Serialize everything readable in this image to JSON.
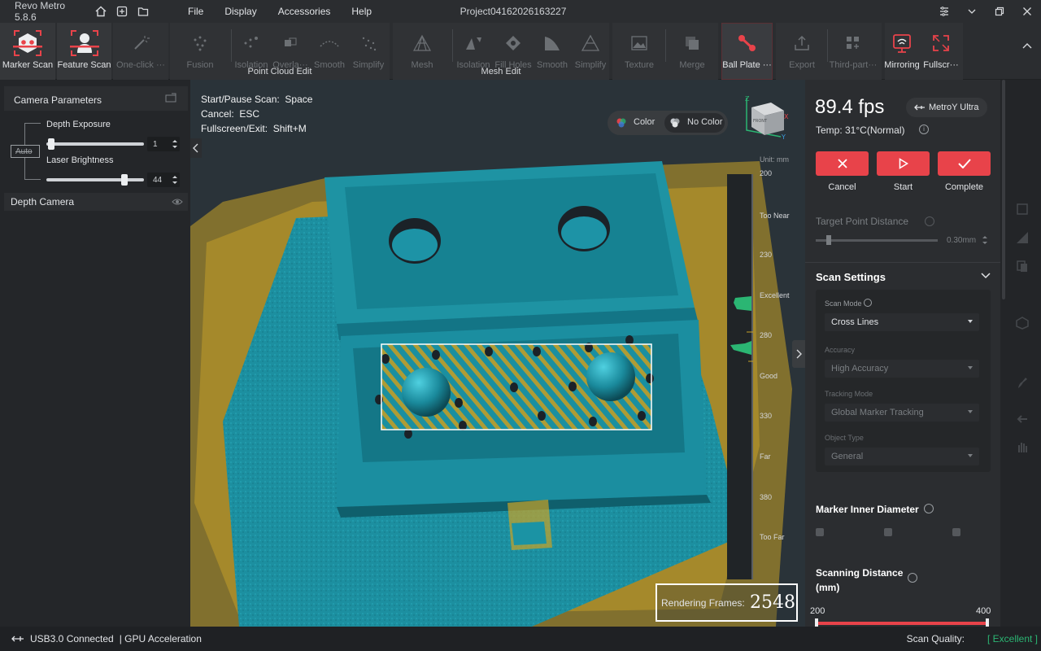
{
  "title_bar": {
    "app_name": "Revo Metro 5.8.6",
    "menu": [
      "File",
      "Display",
      "Accessories",
      "Help"
    ],
    "project_name": "Project04162026163227"
  },
  "toolbar": {
    "marker_scan": "Marker Scan",
    "feature_scan": "Feature Scan",
    "one_click": "One-click ···",
    "fusion": "Fusion",
    "pc_isolation": "Isolation",
    "overlap": "Overla···",
    "pc_smooth": "Smooth",
    "pc_simplify": "Simplify",
    "mesh": "Mesh",
    "mesh_isolation": "Isolation",
    "fill_holes": "Fill Holes",
    "mesh_smooth": "Smooth",
    "mesh_simplify": "Simplify",
    "texture": "Texture",
    "merge": "Merge",
    "ball_plate": "Ball Plate ···",
    "export": "Export",
    "third_party": "Third-part···",
    "mirroring": "Mirroring",
    "fullscreen": "Fullscr···",
    "group_point_cloud": "Point Cloud Edit",
    "group_mesh": "Mesh Edit"
  },
  "camera_params": {
    "title": "Camera Parameters",
    "depth_exposure_label": "Depth Exposure",
    "depth_exposure_value": "1",
    "auto_label": "Auto",
    "laser_brightness_label": "Laser Brightness",
    "laser_brightness_value": "44",
    "depth_exposure_level": 0.02,
    "laser_brightness_level": 0.82,
    "depth_camera": "Depth Camera"
  },
  "viewport": {
    "shortcuts": [
      {
        "label": "Start/Pause Scan:",
        "key": "Space"
      },
      {
        "label": "Cancel:",
        "key": "ESC"
      },
      {
        "label": "Fullscreen/Exit:",
        "key": "Shift+M"
      }
    ],
    "color_btn": "Color",
    "no_color_btn": "No Color",
    "axis_x": "X",
    "axis_y": "Y",
    "axis_z": "Z",
    "cube_label": "FRONT",
    "unit": "Unit: mm",
    "ticks": [
      "200",
      "Too Near",
      "230",
      "Excellent",
      "280",
      "Good",
      "330",
      "Far",
      "380",
      "Too Far"
    ],
    "rendering_frames_label": "Rendering Frames:",
    "rendering_frames_value": "2548"
  },
  "right_panel": {
    "fps": "89.4 fps",
    "device": "MetroY Ultra",
    "temp": "Temp:  31°C(Normal)",
    "cancel": "Cancel",
    "start": "Start",
    "complete": "Complete",
    "target_distance_label": "Target Point Distance",
    "target_distance_value": "0.30mm",
    "target_distance_level": 0.09,
    "scan_settings": "Scan Settings",
    "scan_mode_label": "Scan Mode",
    "scan_mode_value": "Cross Lines",
    "accuracy_label": "Accuracy",
    "accuracy_value": "High Accuracy",
    "tracking_label": "Tracking Mode",
    "tracking_value": "Global Marker Tracking",
    "object_type_label": "Object Type",
    "object_type_value": "General",
    "marker_diameter": "Marker Inner Diameter",
    "scanning_distance": "Scanning Distance (mm)",
    "range_min": "200",
    "range_max": "400"
  },
  "status_bar": {
    "usb": "USB3.0 Connected",
    "gpu": "| GPU Acceleration",
    "quality_label": "Scan Quality:",
    "quality_value": "[ Excellent ]"
  },
  "colors": {
    "accent": "#e8434a",
    "excellent_green": "#2bb673",
    "cloud_teal": "#1b93a4",
    "cloud_yellow": "#c9a227"
  }
}
